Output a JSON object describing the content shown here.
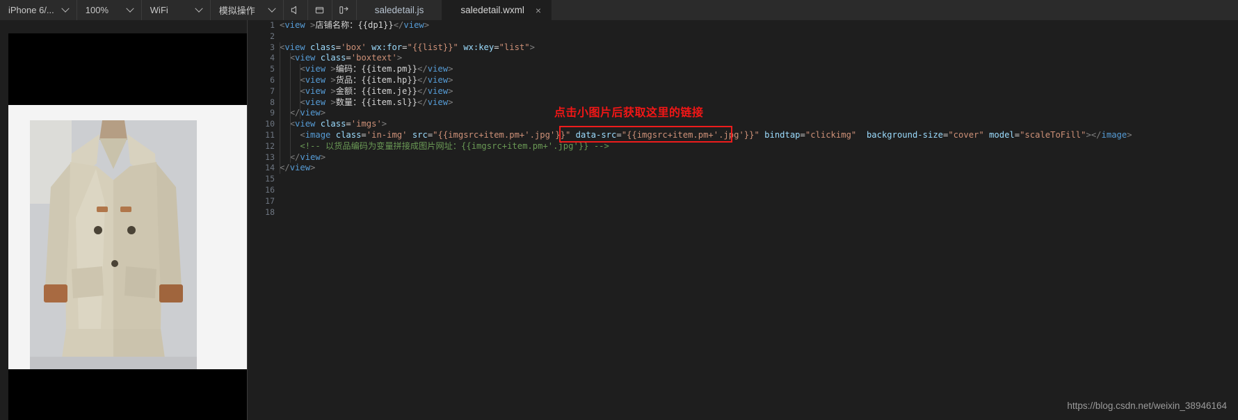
{
  "toolbar": {
    "device": "iPhone 6/...",
    "zoom": "100%",
    "network": "WiFi",
    "simulate": "模拟操作",
    "icons": {
      "mute": "speaker-mute-icon",
      "window": "window-icon",
      "split": "split-pane-icon"
    }
  },
  "tabs": [
    {
      "label": "saledetail.js",
      "active": false,
      "closable": false
    },
    {
      "label": "saledetail.wxml",
      "active": true,
      "closable": true,
      "close": "×"
    }
  ],
  "simulator": {
    "preview_label": "coat-product-photo"
  },
  "annotation": {
    "text": "点击小图片后获取这里的链接",
    "color": "#f21616",
    "box_color": "#ee1c1c",
    "box_target": "data-src=\"{{imgsrc+item.pm+'.jpg'}}\""
  },
  "watermark": "https://blog.csdn.net/weixin_38946164",
  "editor": {
    "line_numbers": [
      1,
      2,
      3,
      4,
      5,
      6,
      7,
      8,
      9,
      10,
      11,
      12,
      13,
      14,
      15,
      16,
      17,
      18
    ],
    "lines": [
      {
        "n": 1,
        "text": "<view >店铺名称：{{dp1}}</view>"
      },
      {
        "n": 2,
        "text": ""
      },
      {
        "n": 3,
        "text": "<view class='box' wx:for=\"{{list}}\" wx:key=\"list\">"
      },
      {
        "n": 4,
        "text": "  <view class='boxtext'>"
      },
      {
        "n": 5,
        "text": "    <view >编码：{{item.pm}}</view>"
      },
      {
        "n": 6,
        "text": "    <view >货品：{{item.hp}}</view>"
      },
      {
        "n": 7,
        "text": "    <view >金额：{{item.je}}</view>"
      },
      {
        "n": 8,
        "text": "    <view >数量：{{item.sl}}</view>"
      },
      {
        "n": 9,
        "text": "  </view>"
      },
      {
        "n": 10,
        "text": "  <view class='imgs'>"
      },
      {
        "n": 11,
        "text": "    <image class='in-img' src=\"{{imgsrc+item.pm+'.jpg'}}\" data-src=\"{{imgsrc+item.pm+'.jpg'}}\" bindtap=\"clickimg\"  background-size=\"cover\" model=\"scaleToFill\"></image>"
      },
      {
        "n": 12,
        "text": "    <!-- 以货品编码为变量拼接成图片网址：{{imgsrc+item.pm+'.jpg'}} -->"
      },
      {
        "n": 13,
        "text": "  </view>"
      },
      {
        "n": 14,
        "text": "</view>"
      },
      {
        "n": 15,
        "text": ""
      },
      {
        "n": 16,
        "text": ""
      },
      {
        "n": 17,
        "text": ""
      },
      {
        "n": 18,
        "text": ""
      }
    ],
    "tokens": {
      "l1": [
        [
          "<",
          "punct"
        ],
        [
          "view",
          "tag"
        ],
        [
          " >",
          "punct"
        ],
        [
          "店铺名称：",
          "text"
        ],
        [
          "{{dp1}}",
          "text"
        ],
        [
          "</",
          "punct"
        ],
        [
          "view",
          "tag"
        ],
        [
          ">",
          "punct"
        ]
      ],
      "l3": [
        [
          "<",
          "punct"
        ],
        [
          "view",
          "tag"
        ],
        [
          " ",
          "text"
        ],
        [
          "class",
          "attr"
        ],
        [
          "=",
          "eq"
        ],
        [
          "'box'",
          "str"
        ],
        [
          " ",
          "text"
        ],
        [
          "wx:for",
          "attr"
        ],
        [
          "=",
          "eq"
        ],
        [
          "\"{{list}}\"",
          "str"
        ],
        [
          " ",
          "text"
        ],
        [
          "wx:key",
          "attr"
        ],
        [
          "=",
          "eq"
        ],
        [
          "\"list\"",
          "str"
        ],
        [
          ">",
          "punct"
        ]
      ],
      "l4": [
        [
          "<",
          "punct"
        ],
        [
          "view",
          "tag"
        ],
        [
          " ",
          "text"
        ],
        [
          "class",
          "attr"
        ],
        [
          "=",
          "eq"
        ],
        [
          "'boxtext'",
          "str"
        ],
        [
          ">",
          "punct"
        ]
      ],
      "l5": [
        [
          "<",
          "punct"
        ],
        [
          "view",
          "tag"
        ],
        [
          " >",
          "punct"
        ],
        [
          "编码：{{item.pm}}",
          "text"
        ],
        [
          "</",
          "punct"
        ],
        [
          "view",
          "tag"
        ],
        [
          ">",
          "punct"
        ]
      ],
      "l6": [
        [
          "<",
          "punct"
        ],
        [
          "view",
          "tag"
        ],
        [
          " >",
          "punct"
        ],
        [
          "货品：{{item.hp}}",
          "text"
        ],
        [
          "</",
          "punct"
        ],
        [
          "view",
          "tag"
        ],
        [
          ">",
          "punct"
        ]
      ],
      "l7": [
        [
          "<",
          "punct"
        ],
        [
          "view",
          "tag"
        ],
        [
          " >",
          "punct"
        ],
        [
          "金额：{{item.je}}",
          "text"
        ],
        [
          "</",
          "punct"
        ],
        [
          "view",
          "tag"
        ],
        [
          ">",
          "punct"
        ]
      ],
      "l8": [
        [
          "<",
          "punct"
        ],
        [
          "view",
          "tag"
        ],
        [
          " >",
          "punct"
        ],
        [
          "数量：{{item.sl}}",
          "text"
        ],
        [
          "</",
          "punct"
        ],
        [
          "view",
          "tag"
        ],
        [
          ">",
          "punct"
        ]
      ],
      "l9": [
        [
          "</",
          "punct"
        ],
        [
          "view",
          "tag"
        ],
        [
          ">",
          "punct"
        ]
      ],
      "l10": [
        [
          "<",
          "punct"
        ],
        [
          "view",
          "tag"
        ],
        [
          " ",
          "text"
        ],
        [
          "class",
          "attr"
        ],
        [
          "=",
          "eq"
        ],
        [
          "'imgs'",
          "str"
        ],
        [
          ">",
          "punct"
        ]
      ],
      "l11": [
        [
          "<",
          "punct"
        ],
        [
          "image",
          "tag"
        ],
        [
          " ",
          "text"
        ],
        [
          "class",
          "attr"
        ],
        [
          "=",
          "eq"
        ],
        [
          "'in-img'",
          "str"
        ],
        [
          " ",
          "text"
        ],
        [
          "src",
          "attr"
        ],
        [
          "=",
          "eq"
        ],
        [
          "\"{{imgsrc+item.pm+'.jpg'}}\"",
          "str"
        ],
        [
          " ",
          "text"
        ],
        [
          "data-src",
          "attr"
        ],
        [
          "=",
          "eq"
        ],
        [
          "\"{{imgsrc+item.pm+'.jpg'}}\"",
          "str"
        ],
        [
          " ",
          "text"
        ],
        [
          "bindtap",
          "attr"
        ],
        [
          "=",
          "eq"
        ],
        [
          "\"clickimg\"",
          "str"
        ],
        [
          "  ",
          "text"
        ],
        [
          "background-size",
          "attr"
        ],
        [
          "=",
          "eq"
        ],
        [
          "\"cover\"",
          "str"
        ],
        [
          " ",
          "text"
        ],
        [
          "model",
          "attr"
        ],
        [
          "=",
          "eq"
        ],
        [
          "\"scaleToFill\"",
          "str"
        ],
        [
          ">",
          "punct"
        ],
        [
          "</",
          "punct"
        ],
        [
          "image",
          "tag"
        ],
        [
          ">",
          "punct"
        ]
      ],
      "l12": [
        [
          "<!-- 以货品编码为变量拼接成图片网址：{{imgsrc+item.pm+'.jpg'}} -->",
          "comment"
        ]
      ],
      "l13": [
        [
          "</",
          "punct"
        ],
        [
          "view",
          "tag"
        ],
        [
          ">",
          "punct"
        ]
      ],
      "l14": [
        [
          "</",
          "punct"
        ],
        [
          "view",
          "tag"
        ],
        [
          ">",
          "punct"
        ]
      ]
    }
  }
}
